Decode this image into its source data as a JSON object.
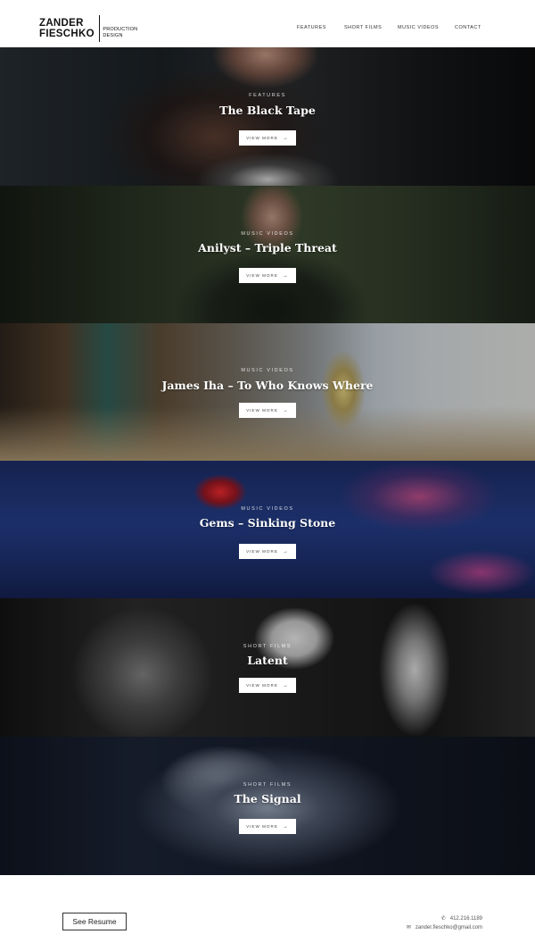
{
  "brand": {
    "name_line1": "ZANDER",
    "name_line2": "FIESCHKO",
    "sub_line1": "PRODUCTION",
    "sub_line2": "DESIGN"
  },
  "nav": {
    "features": "FEATURES",
    "short_films": "SHORT FILMS",
    "music_videos": "MUSIC VIDEOS",
    "contact": "CONTACT"
  },
  "projects": [
    {
      "category": "FEATURES",
      "title": "The Black Tape",
      "button": "VIEW MORE"
    },
    {
      "category": "MUSIC VIDEOS",
      "title": "Anilyst – Triple Threat",
      "button": "VIEW MORE"
    },
    {
      "category": "MUSIC VIDEOS",
      "title": "James Iha – To Who Knows Where",
      "button": "VIEW MORE"
    },
    {
      "category": "MUSIC VIDEOS",
      "title": "Gems – Sinking Stone",
      "button": "VIEW MORE"
    },
    {
      "category": "SHORT FILMS",
      "title": "Latent",
      "button": "VIEW MORE"
    },
    {
      "category": "SHORT FILMS",
      "title": "The Signal",
      "button": "VIEW MORE"
    }
  ],
  "footer": {
    "resume_button": "See Resume",
    "phone": "412.216.1189",
    "email": "zander.fieschko@gmail.com",
    "phone_icon": "phone-icon",
    "email_icon": "envelope-icon"
  }
}
